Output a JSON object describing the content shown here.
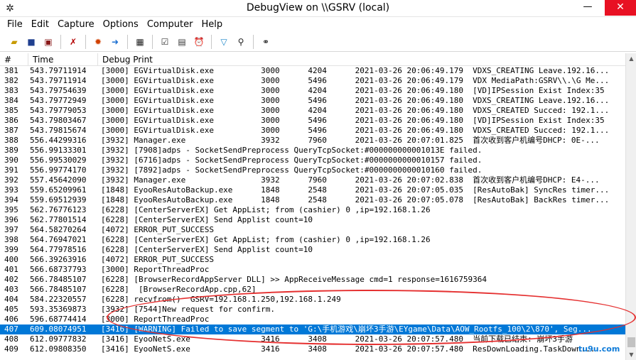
{
  "window": {
    "title": "DebugView on \\\\GSRV (local)",
    "app_icon": "debugview-app-icon",
    "minimize_glyph": "—",
    "close_glyph": "✕"
  },
  "menu": {
    "items": [
      {
        "label": "File"
      },
      {
        "label": "Edit"
      },
      {
        "label": "Capture"
      },
      {
        "label": "Options"
      },
      {
        "label": "Computer"
      },
      {
        "label": "Help"
      }
    ]
  },
  "toolbar": {
    "icons": [
      "open-icon",
      "save-icon",
      "save-all-icon",
      "clear-display-icon",
      "capture-icon",
      "autoscroll-icon",
      "filter-icon",
      "clock-time-icon",
      "history-icon",
      "highlight-icon",
      "find-icon",
      "binoculars-icon"
    ]
  },
  "list": {
    "headers": {
      "num": "#",
      "time": "Time",
      "print": "Debug Print"
    },
    "rows": [
      {
        "num": "381",
        "time": "543.79711914",
        "print": "[3000] EGVirtualDisk.exe          3000      4204      2021-03-26 20:06:49.179  VDXS_CREATING Leave.192.16..."
      },
      {
        "num": "382",
        "time": "543.79711914",
        "print": "[3000] EGVirtualDisk.exe          3000      5496      2021-03-26 20:06:49.179  VDX MediaPath:GSRV\\\\.\\G Me..."
      },
      {
        "num": "383",
        "time": "543.79754639",
        "print": "[3000] EGVirtualDisk.exe          3000      4204      2021-03-26 20:06:49.180  [VD]IPSession Exist Index:35"
      },
      {
        "num": "384",
        "time": "543.79772949",
        "print": "[3000] EGVirtualDisk.exe          3000      5496      2021-03-26 20:06:49.180  VDXS_CREATING Leave.192.16..."
      },
      {
        "num": "385",
        "time": "543.79779053",
        "print": "[3000] EGVirtualDisk.exe          3000      4204      2021-03-26 20:06:49.180  VDXS_CREATED Succed: 192.1..."
      },
      {
        "num": "386",
        "time": "543.79803467",
        "print": "[3000] EGVirtualDisk.exe          3000      5496      2021-03-26 20:06:49.180  [VD]IPSession Exist Index:35"
      },
      {
        "num": "387",
        "time": "543.79815674",
        "print": "[3000] EGVirtualDisk.exe          3000      5496      2021-03-26 20:06:49.180  VDXS_CREATED Succed: 192.1..."
      },
      {
        "num": "388",
        "time": "556.44299316",
        "print": "[3932] Manager.exe                3932      7960      2021-03-26 20:07:01.825  首次收到客户机编号DHCP: 0E-..."
      },
      {
        "num": "389",
        "time": "556.99133301",
        "print": "[3932] [7908]adps - SocketSendPreprocess QueryTcpSocket:#000000000001013E failed."
      },
      {
        "num": "390",
        "time": "556.99530029",
        "print": "[3932] [6716]adps - SocketSendPreprocess QueryTcpSocket:#0000000000010157 failed."
      },
      {
        "num": "391",
        "time": "556.99774170",
        "print": "[3932] [7892]adps - SocketSendPreprocess QueryTcpSocket:#0000000000010160 failed."
      },
      {
        "num": "392",
        "time": "557.45642090",
        "print": "[3932] Manager.exe                3932      7960      2021-03-26 20:07:02.838  首次收到客户机编号DHCP: E4-..."
      },
      {
        "num": "393",
        "time": "559.65209961",
        "print": "[1848] EyooResAutoBackup.exe      1848      2548      2021-03-26 20:07:05.035  [ResAutoBak] SyncRes timer..."
      },
      {
        "num": "394",
        "time": "559.69512939",
        "print": "[1848] EyooResAutoBackup.exe      1848      2548      2021-03-26 20:07:05.078  [ResAutoBak] BackRes timer..."
      },
      {
        "num": "395",
        "time": "562.76776123",
        "print": "[6228] [CenterServerEX] Get AppList; from (cashier) 0 ,ip=192.168.1.26"
      },
      {
        "num": "396",
        "time": "562.77801514",
        "print": "[6228] [CenterServerEX] Send Applist count=10"
      },
      {
        "num": "397",
        "time": "564.58270264",
        "print": "[4072] ERROR_PUT_SUCCESS"
      },
      {
        "num": "398",
        "time": "564.76947021",
        "print": "[6228] [CenterServerEX] Get AppList; from (cashier) 0 ,ip=192.168.1.26"
      },
      {
        "num": "399",
        "time": "564.77978516",
        "print": "[6228] [CenterServerEX] Send Applist count=10"
      },
      {
        "num": "400",
        "time": "566.39263916",
        "print": "[4072] ERROR_PUT_SUCCESS"
      },
      {
        "num": "401",
        "time": "566.68737793",
        "print": "[3000] ReportThreadProc"
      },
      {
        "num": "402",
        "time": "566.78485107",
        "print": "[6228] [BrowserRecordAppServer DLL] >> AppReceiveMessage cmd=1 response=1616759364"
      },
      {
        "num": "403",
        "time": "566.78485107",
        "print": "[6228]  [BrowserRecordApp.cpp,62]"
      },
      {
        "num": "404",
        "time": "584.22320557",
        "print": "[6228] recvfrom()  GSRV=192.168.1.250,192.168.1.249"
      },
      {
        "num": "405",
        "time": "593.35369873",
        "print": "[3932] [7544]New request for confirm."
      },
      {
        "num": "406",
        "time": "596.68774414",
        "print": "[3000] ReportThreadProc"
      },
      {
        "num": "407",
        "time": "609.08074951",
        "print": "[3416] [WARNING] Failed to save segment to 'G:\\手机游戏\\崩坏3手游\\EYgame\\Data\\AOW_Rootfs_100\\2\\870', Seg...",
        "selected": true
      },
      {
        "num": "408",
        "time": "612.09777832",
        "print": "[3416] EyooNetS.exe               3416      3408      2021-03-26 20:07:57.480  当前下载已结束: 崩坏3手游"
      },
      {
        "num": "409",
        "time": "612.09808350",
        "print": "[3416] EyooNetS.exe               3416      3408      2021-03-26 20:07:57.480  ResDownLoading.TaskDown..."
      }
    ]
  },
  "watermark": "tu9u.com",
  "colors": {
    "selection": "#0078d7",
    "annotation": "#e53030",
    "close_button": "#e81123"
  }
}
